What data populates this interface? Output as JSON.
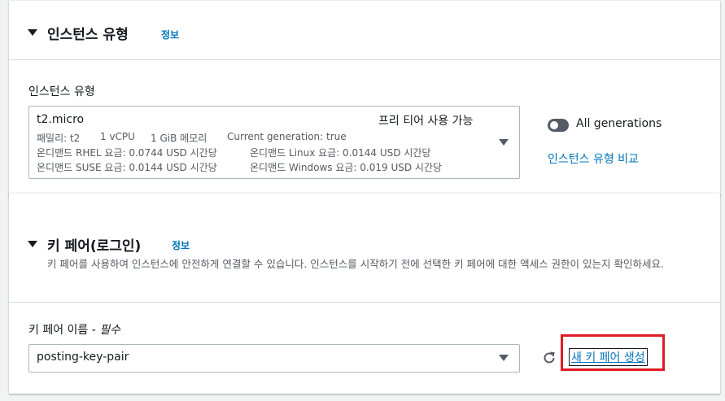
{
  "instance_type_section": {
    "title": "인스턴스 유형",
    "info_label": "정보",
    "field_label": "인스턴스 유형",
    "selected": {
      "name": "t2.micro",
      "free_tier": "프리 티어 사용 가능",
      "line1_family": "패밀리: t2",
      "line1_vcpu": "1 vCPU",
      "line1_mem": "1 GiB 메모리",
      "line1_gen": "Current generation: true",
      "line2_a": "온디맨드 RHEL 요금: 0.0744 USD 시간당",
      "line2_b": "온디맨드 Linux 요금: 0.0144 USD 시간당",
      "line3_a": "온디맨드 SUSE 요금: 0.0144 USD 시간당",
      "line3_b": "온디맨드 Windows 요금: 0.019 USD 시간당"
    },
    "toggle_label": "All generations",
    "toggle_on": false,
    "compare_link": "인스턴스 유형 비교"
  },
  "key_pair_section": {
    "title": "키 페어(로그인)",
    "info_label": "정보",
    "description": "키 페어를 사용하여 인스턴스에 안전하게 연결할 수 있습니다. 인스턴스를 시작하기 전에 선택한 키 페어에 대한 액세스 권한이 있는지 확인하세요.",
    "field_label": "키 페어 이름 - ",
    "field_required": "필수",
    "selected_value": "posting-key-pair",
    "create_link": "새 키 페어 생성"
  },
  "colors": {
    "link": "#0073bb",
    "highlight": "#e11b22",
    "toggle_off": "#545b64"
  }
}
